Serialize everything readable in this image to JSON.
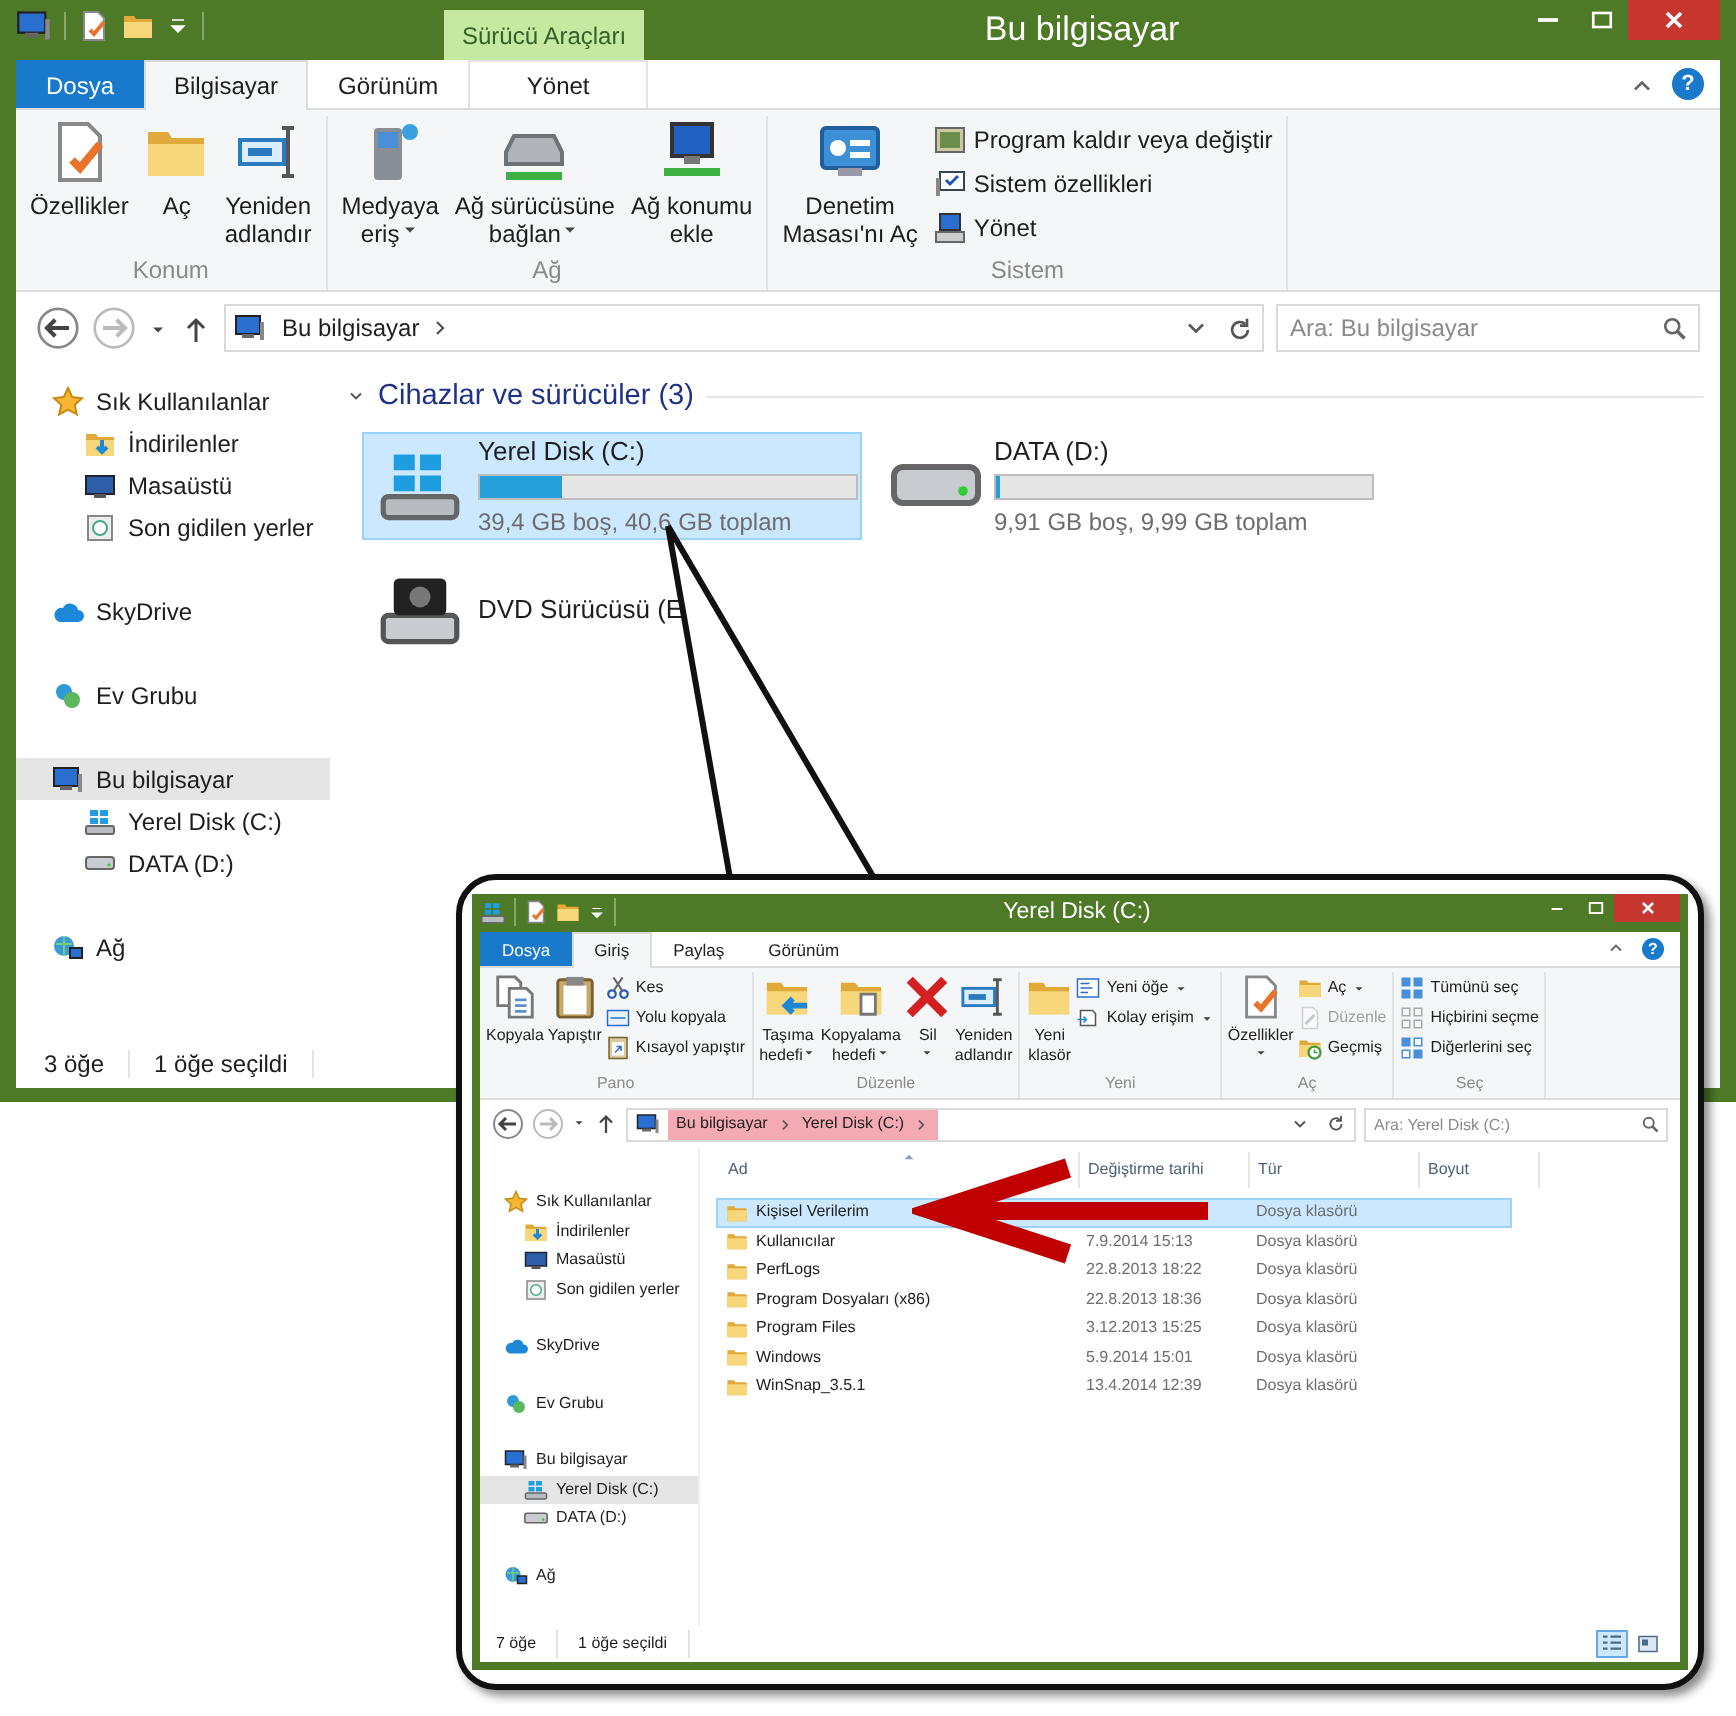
{
  "window": {
    "title": "Bu bilgisayar",
    "context_group": "Sürücü Araçları"
  },
  "ribbon_tabs": [
    {
      "label": "Dosya",
      "kind": "file",
      "selected": false
    },
    {
      "label": "Bilgisayar",
      "kind": "tab",
      "selected": true
    },
    {
      "label": "Görünüm",
      "kind": "tab",
      "selected": false
    },
    {
      "label": "Yönet",
      "kind": "context",
      "selected": false
    }
  ],
  "help_button": "?",
  "ribbon_groups": [
    {
      "label": "Konum",
      "large": [
        {
          "lines": [
            "Özellikler"
          ],
          "dropdown": false
        },
        {
          "lines": [
            "Aç"
          ],
          "dropdown": false
        },
        {
          "lines": [
            "Yeniden",
            "adlandır"
          ],
          "dropdown": false
        }
      ]
    },
    {
      "label": "Ağ",
      "large": [
        {
          "lines": [
            "Medyaya",
            "eriş"
          ],
          "dropdown": true
        },
        {
          "lines": [
            "Ağ sürücüsüne",
            "bağlan"
          ],
          "dropdown": true
        },
        {
          "lines": [
            "Ağ konumu",
            "ekle"
          ],
          "dropdown": false
        }
      ]
    },
    {
      "label": "Sistem",
      "large": [
        {
          "lines": [
            "Denetim",
            "Masası'nı Aç"
          ],
          "dropdown": false
        }
      ],
      "small": [
        {
          "label": "Program kaldır veya değiştir",
          "dropdown": false,
          "disabled": false
        },
        {
          "label": "Sistem özellikleri",
          "dropdown": false,
          "disabled": false
        },
        {
          "label": "Yönet",
          "dropdown": false,
          "disabled": false
        }
      ]
    }
  ],
  "address": {
    "path": [
      "Bu bilgisayar"
    ],
    "search_placeholder": "Ara: Bu bilgisayar"
  },
  "navigation": [
    {
      "label": "Sık Kullanılanlar",
      "kind": "favorites",
      "selected": false,
      "children": [
        {
          "label": "İndirilenler",
          "kind": "downloads",
          "selected": false
        },
        {
          "label": "Masaüstü",
          "kind": "desktop",
          "selected": false
        },
        {
          "label": "Son gidilen yerler",
          "kind": "recent",
          "selected": false
        }
      ]
    },
    {
      "label": "SkyDrive",
      "kind": "cloud",
      "selected": false
    },
    {
      "label": "Ev Grubu",
      "kind": "homegroup",
      "selected": false
    },
    {
      "label": "Bu bilgisayar",
      "kind": "computer",
      "selected": true,
      "children": [
        {
          "label": "Yerel Disk (C:)",
          "kind": "system_disk",
          "selected": false
        },
        {
          "label": "DATA (D:)",
          "kind": "disk",
          "selected": false
        }
      ]
    },
    {
      "label": "Ağ",
      "kind": "network",
      "selected": false
    }
  ],
  "content": {
    "group_header": "Cihazlar ve sürücüler (3)",
    "drives": [
      {
        "name": "Yerel Disk (C:)",
        "kind": "system_disk",
        "selected": true,
        "level": 0.22,
        "info": "39,4 GB boş, 40,6 GB toplam"
      },
      {
        "name": "DATA (D:)",
        "kind": "disk",
        "selected": false,
        "level": 0.01,
        "info": "9,91 GB boş, 9,99 GB toplam"
      },
      {
        "name": "DVD Sürücüsü (E",
        "kind": "dvd",
        "selected": false
      }
    ]
  },
  "status_bar": {
    "items": "3 öğe",
    "selection": "1 öğe seçildi"
  },
  "inset": {
    "window": {
      "title": "Yerel Disk (C:)"
    },
    "ribbon_tabs": [
      {
        "label": "Dosya",
        "kind": "file",
        "selected": false
      },
      {
        "label": "Giriş",
        "kind": "tab",
        "selected": true
      },
      {
        "label": "Paylaş",
        "kind": "tab",
        "selected": false
      },
      {
        "label": "Görünüm",
        "kind": "tab",
        "selected": false
      }
    ],
    "help_button": "?",
    "ribbon_groups": [
      {
        "label": "Pano",
        "large": [
          {
            "lines": [
              "Kopyala"
            ],
            "dropdown": false
          },
          {
            "lines": [
              "Yapıştır"
            ],
            "dropdown": false
          }
        ],
        "small": [
          {
            "label": "Kes",
            "dropdown": false,
            "disabled": false
          },
          {
            "label": "Yolu kopyala",
            "dropdown": false,
            "disabled": false
          },
          {
            "label": "Kısayol yapıştır",
            "dropdown": false,
            "disabled": false
          }
        ]
      },
      {
        "label": "Düzenle",
        "large": [
          {
            "lines": [
              "Taşıma",
              "hedefi"
            ],
            "dropdown": true
          },
          {
            "lines": [
              "Kopyalama",
              "hedefi"
            ],
            "dropdown": true
          },
          {
            "lines": [
              "Sil"
            ],
            "dropdown": true
          },
          {
            "lines": [
              "Yeniden",
              "adlandır"
            ],
            "dropdown": false
          }
        ]
      },
      {
        "label": "Yeni",
        "large": [
          {
            "lines": [
              "Yeni",
              "klasör"
            ],
            "dropdown": false
          }
        ],
        "small": [
          {
            "label": "Yeni öğe",
            "dropdown": true,
            "disabled": false
          },
          {
            "label": "Kolay erişim",
            "dropdown": true,
            "disabled": false
          }
        ]
      },
      {
        "label": "Aç",
        "large": [
          {
            "lines": [
              "Özellikler"
            ],
            "dropdown": true
          }
        ],
        "small": [
          {
            "label": "Aç",
            "dropdown": true,
            "disabled": false
          },
          {
            "label": "Düzenle",
            "dropdown": false,
            "disabled": true
          },
          {
            "label": "Geçmiş",
            "dropdown": false,
            "disabled": false
          }
        ]
      },
      {
        "label": "Seç",
        "small": [
          {
            "label": "Tümünü seç",
            "dropdown": false,
            "disabled": false
          },
          {
            "label": "Hiçbirini seçme",
            "dropdown": false,
            "disabled": false
          },
          {
            "label": "Diğerlerini seç",
            "dropdown": false,
            "disabled": false
          }
        ]
      }
    ],
    "address": {
      "path": [
        "Bu bilgisayar",
        "Yerel Disk (C:)"
      ],
      "highlighted": true,
      "search_placeholder": "Ara: Yerel Disk (C:)"
    },
    "navigation": [
      {
        "label": "Sık Kullanılanlar",
        "kind": "favorites",
        "selected": false,
        "children": [
          {
            "label": "İndirilenler",
            "kind": "downloads",
            "selected": false
          },
          {
            "label": "Masaüstü",
            "kind": "desktop",
            "selected": false
          },
          {
            "label": "Son gidilen yerler",
            "kind": "recent",
            "selected": false
          }
        ]
      },
      {
        "label": "SkyDrive",
        "kind": "cloud",
        "selected": false
      },
      {
        "label": "Ev Grubu",
        "kind": "homegroup",
        "selected": false
      },
      {
        "label": "Bu bilgisayar",
        "kind": "computer",
        "selected": false,
        "children": [
          {
            "label": "Yerel Disk (C:)",
            "kind": "system_disk",
            "selected": true
          },
          {
            "label": "DATA (D:)",
            "kind": "disk",
            "selected": false
          }
        ]
      },
      {
        "label": "Ağ",
        "kind": "network",
        "selected": false
      }
    ],
    "files": {
      "columns": [
        "Ad",
        "Değiştirme tarihi",
        "Tür",
        "Boyut"
      ],
      "rows": [
        {
          "name": "Kişisel Verilerim",
          "type": "Dosya klasörü",
          "selected": true
        },
        {
          "name": "Kullanıcılar",
          "modified": "7.9.2014 15:13",
          "type": "Dosya klasörü",
          "selected": false
        },
        {
          "name": "PerfLogs",
          "modified": "22.8.2013 18:22",
          "type": "Dosya klasörü",
          "selected": false
        },
        {
          "name": "Program Dosyaları (x86)",
          "modified": "22.8.2013 18:36",
          "type": "Dosya klasörü",
          "selected": false
        },
        {
          "name": "Program Files",
          "modified": "3.12.2013 15:25",
          "type": "Dosya klasörü",
          "selected": false
        },
        {
          "name": "Windows",
          "modified": "5.9.2014 15:01",
          "type": "Dosya klasörü",
          "selected": false
        },
        {
          "name": "WinSnap_3.5.1",
          "modified": "13.4.2014 12:39",
          "type": "Dosya klasörü",
          "selected": false
        }
      ]
    },
    "status_bar": {
      "items": "7 öğe",
      "selection": "1 öğe seçildi"
    },
    "view_buttons": [
      {
        "kind": "details",
        "selected": true
      },
      {
        "kind": "tiles",
        "selected": false
      }
    ]
  }
}
